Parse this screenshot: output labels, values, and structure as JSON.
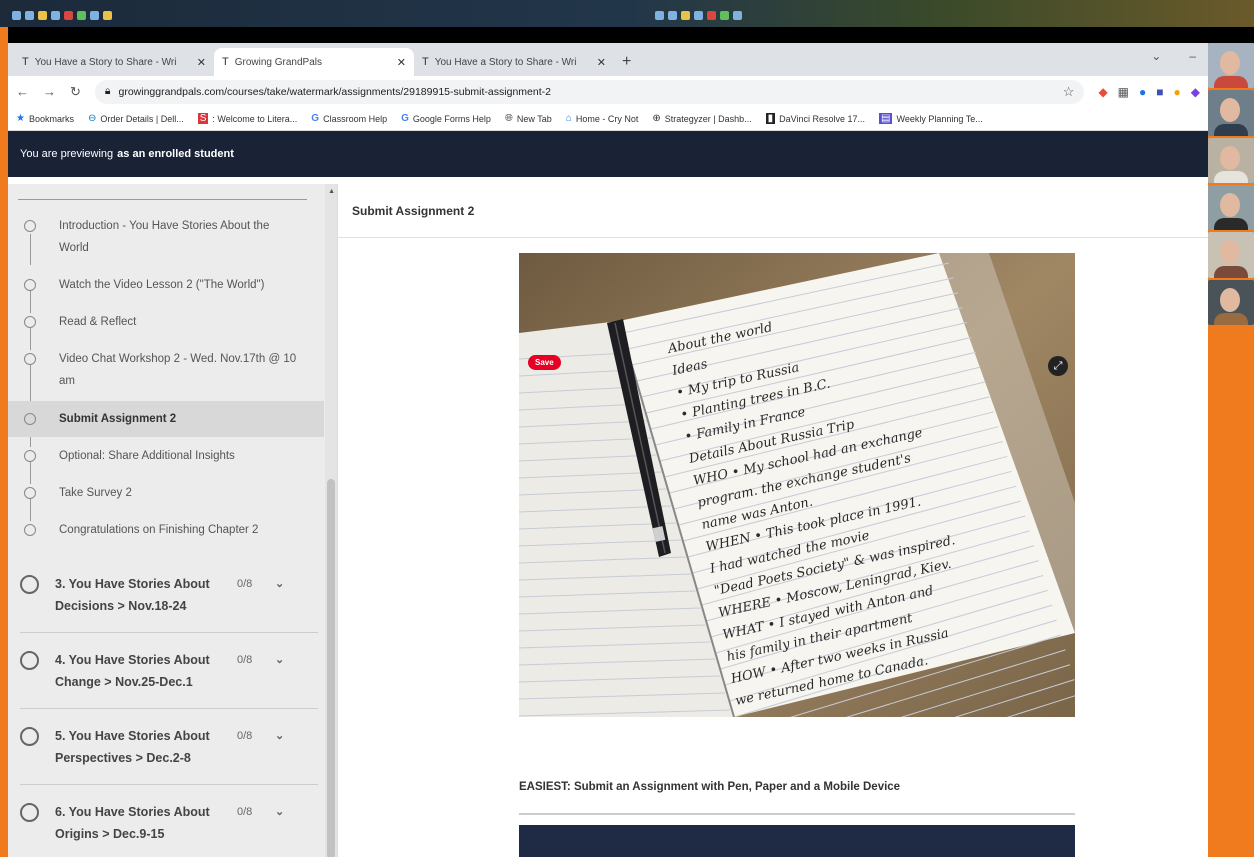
{
  "browser": {
    "tabs": [
      {
        "label": "You Have a Story to Share - Wri",
        "active": false
      },
      {
        "label": "Growing GrandPals",
        "active": true
      },
      {
        "label": "You Have a Story to Share - Wri",
        "active": false
      }
    ],
    "new_tab": "+",
    "url": "growinggrandpals.com/courses/take/watermark/assignments/29189915-submit-assignment-2",
    "bookmarks": [
      {
        "label": "Bookmarks",
        "icon": "star-icon"
      },
      {
        "label": "Order Details | Dell...",
        "icon": "dell-icon"
      },
      {
        "label": ": Welcome to Litera...",
        "icon": "literacy-icon"
      },
      {
        "label": "Classroom Help",
        "icon": "google-icon"
      },
      {
        "label": "Google Forms Help",
        "icon": "google-icon"
      },
      {
        "label": "New Tab",
        "icon": "globe-icon"
      },
      {
        "label": "Home - Cry Not",
        "icon": "home-icon"
      },
      {
        "label": "Strategyzer | Dashb...",
        "icon": "strategyzer-icon"
      },
      {
        "label": "DaVinci Resolve 17...",
        "icon": "davinci-icon"
      },
      {
        "label": "Weekly Planning Te...",
        "icon": "doc-icon"
      }
    ]
  },
  "preview": {
    "prefix": "You are previewing",
    "role": "as an enrolled student"
  },
  "sidebar": {
    "lessons": [
      {
        "label": "Introduction - You Have Stories About the World",
        "active": false
      },
      {
        "label": "Watch the Video Lesson 2 (\"The World\")",
        "active": false
      },
      {
        "label": "Read & Reflect",
        "active": false
      },
      {
        "label": "Video Chat Workshop 2 - Wed. Nov.17th @ 10 am",
        "active": false
      },
      {
        "label": "Submit Assignment 2",
        "active": true
      },
      {
        "label": "Optional: Share Additional Insights",
        "active": false
      },
      {
        "label": "Take Survey 2",
        "active": false
      },
      {
        "label": "Congratulations on Finishing Chapter 2",
        "active": false
      }
    ],
    "chapters": [
      {
        "title": "3. You Have Stories About Decisions > Nov.18-24",
        "count": "0/8"
      },
      {
        "title": "4. You Have Stories About Change > Nov.25-Dec.1",
        "count": "0/8"
      },
      {
        "title": "5. You Have Stories About Perspectives > Dec.2-8",
        "count": "0/8"
      },
      {
        "title": "6. You Have Stories About Origins > Dec.9-15",
        "count": "0/8"
      }
    ]
  },
  "main": {
    "heading": "Submit Assignment 2",
    "save_label": "Save",
    "notebook_lines": [
      "About the world",
      "Ideas",
      "• My trip to Russia",
      "• Planting trees in B.C.",
      "• Family in France",
      "Details About Russia Trip",
      "WHO • My school had an exchange",
      "program. the exchange student's",
      "name was Anton.",
      "WHEN • This took place in 1991.",
      "I had watched the movie",
      "\"Dead Poets Society\" & was inspired.",
      "WHERE • Moscow, Leningrad, Kiev.",
      "WHAT • I stayed with Anton and",
      "his family in their apartment",
      "HOW • After two weeks in Russia",
      "we returned home to Canada."
    ],
    "instruction": "EASIEST: Submit an Assignment with Pen, Paper and a Mobile Device"
  },
  "colors": {
    "background": "#f07a1e",
    "banner": "#1a2336",
    "pin_save": "#e60023"
  }
}
